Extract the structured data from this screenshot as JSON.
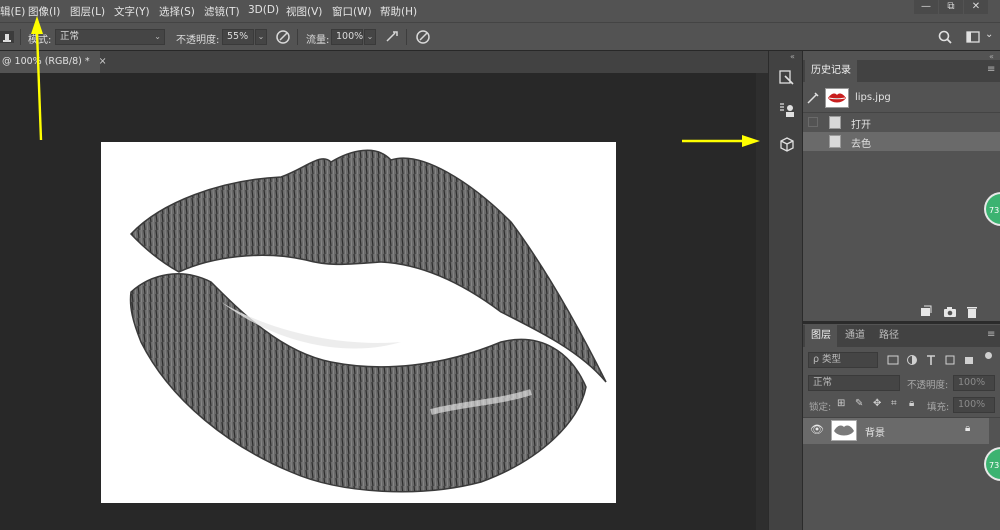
{
  "menubar": {
    "items": [
      "辑(E)",
      "图像(I)",
      "图层(L)",
      "文字(Y)",
      "选择(S)",
      "滤镜(T)",
      "3D(D)",
      "视图(V)",
      "窗口(W)",
      "帮助(H)"
    ],
    "window_buttons": [
      "—",
      "⧉",
      "✕"
    ]
  },
  "options": {
    "mode_label": "模式:",
    "mode_value": "正常",
    "opacity_label": "不透明度:",
    "opacity_value": "55%",
    "flow_label": "流量:",
    "flow_value": "100%"
  },
  "document": {
    "tab_title": "@ 100% (RGB/8) *",
    "close_glyph": "×"
  },
  "history_panel": {
    "tab_label": "历史记录",
    "snapshot_name": "lips.jpg",
    "steps": [
      "打开",
      "去色"
    ]
  },
  "layers_panel": {
    "tabs": [
      "图层",
      "通道",
      "路径"
    ],
    "filter_placeholder": "ρ 类型",
    "blend_mode": "正常",
    "opacity_label": "不透明度:",
    "opacity_value": "100%",
    "lock_label": "锁定:",
    "fill_label": "填充:",
    "fill_value": "100%",
    "layer_name": "背景"
  },
  "badges": [
    "73",
    "73"
  ],
  "colors": {
    "accent_arrow": "#ffff00",
    "panel_bg": "#535353",
    "canvas_bg": "#282828",
    "selected_row": "#6a6a6a",
    "badge_green": "#3cb371"
  }
}
